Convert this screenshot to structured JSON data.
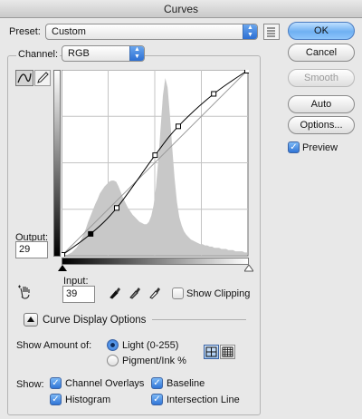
{
  "window": {
    "title": "Curves"
  },
  "preset": {
    "label": "Preset:",
    "value": "Custom"
  },
  "channel": {
    "label": "Channel:",
    "value": "RGB"
  },
  "buttons": {
    "ok": "OK",
    "cancel": "Cancel",
    "smooth": "Smooth",
    "auto": "Auto",
    "options": "Options..."
  },
  "preview": {
    "label": "Preview",
    "checked": true
  },
  "output": {
    "label": "Output:",
    "value": "29"
  },
  "input": {
    "label": "Input:",
    "value": "39"
  },
  "show_clipping": {
    "label": "Show Clipping",
    "checked": false
  },
  "curve_display": {
    "label": "Curve Display Options"
  },
  "show_amount": {
    "label": "Show Amount of:",
    "options": [
      {
        "label": "Light  (0-255)",
        "selected": true
      },
      {
        "label": "Pigment/Ink %",
        "selected": false
      }
    ]
  },
  "show": {
    "label": "Show:",
    "items": [
      {
        "label": "Channel Overlays",
        "checked": true
      },
      {
        "label": "Baseline",
        "checked": true
      },
      {
        "label": "Histogram",
        "checked": true
      },
      {
        "label": "Intersection Line",
        "checked": true
      }
    ]
  },
  "curve": {
    "points": [
      [
        0,
        0
      ],
      [
        39,
        29
      ],
      [
        75,
        65
      ],
      [
        128,
        138
      ],
      [
        160,
        178
      ],
      [
        209,
        223
      ],
      [
        255,
        255
      ]
    ]
  },
  "histogram": {
    "levels": [
      0,
      0,
      0,
      1,
      2,
      4,
      6,
      9,
      13,
      17,
      22,
      28,
      33,
      38,
      43,
      47,
      52,
      55,
      58,
      60,
      62,
      63,
      63,
      62,
      58,
      53,
      48,
      44,
      40,
      37,
      34,
      32,
      30,
      28,
      27,
      26,
      26,
      28,
      33,
      42,
      57,
      80,
      108,
      135,
      150,
      142,
      118,
      90,
      65,
      45,
      32,
      25,
      20,
      17,
      15,
      13,
      12,
      11,
      10,
      9,
      9,
      8,
      8,
      7,
      7,
      6,
      6,
      6,
      5,
      5,
      5,
      4,
      4,
      4,
      3,
      3,
      3,
      3,
      2,
      2
    ]
  },
  "colors": {
    "accent": "#2f74d6",
    "curve": "#000000",
    "histogram": "#c8c8c8"
  }
}
